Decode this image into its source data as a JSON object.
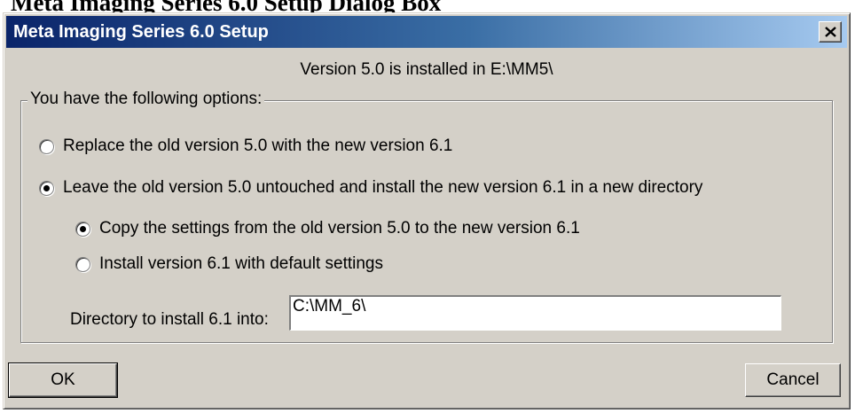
{
  "page": {
    "heading": "Meta Imaging Series 6.0 Setup Dialog Box"
  },
  "window": {
    "title": "Meta Imaging Series 6.0 Setup",
    "close_icon": "close-icon"
  },
  "info": {
    "installed_text": "Version 5.0 is installed in E:\\MM5\\"
  },
  "options": {
    "legend": "You have the following options:",
    "replace_label": "Replace the old version 5.0 with the new version 6.1",
    "replace_checked": false,
    "leave_label": "Leave the old version 5.0 untouched and install the new version 6.1 in a new directory",
    "leave_checked": true,
    "copy_label": "Copy the settings from the old version 5.0 to the new version 6.1",
    "copy_checked": true,
    "default_label": "Install version 6.1 with default settings",
    "default_checked": false,
    "directory_label": "Directory to install 6.1 into:",
    "directory_value": "C:\\MM_6\\"
  },
  "buttons": {
    "ok_label": "OK",
    "cancel_label": "Cancel"
  },
  "colors": {
    "titlebar_start": "#0a246a",
    "titlebar_end": "#a6caf0",
    "dialog_face": "#d4d0c8"
  }
}
